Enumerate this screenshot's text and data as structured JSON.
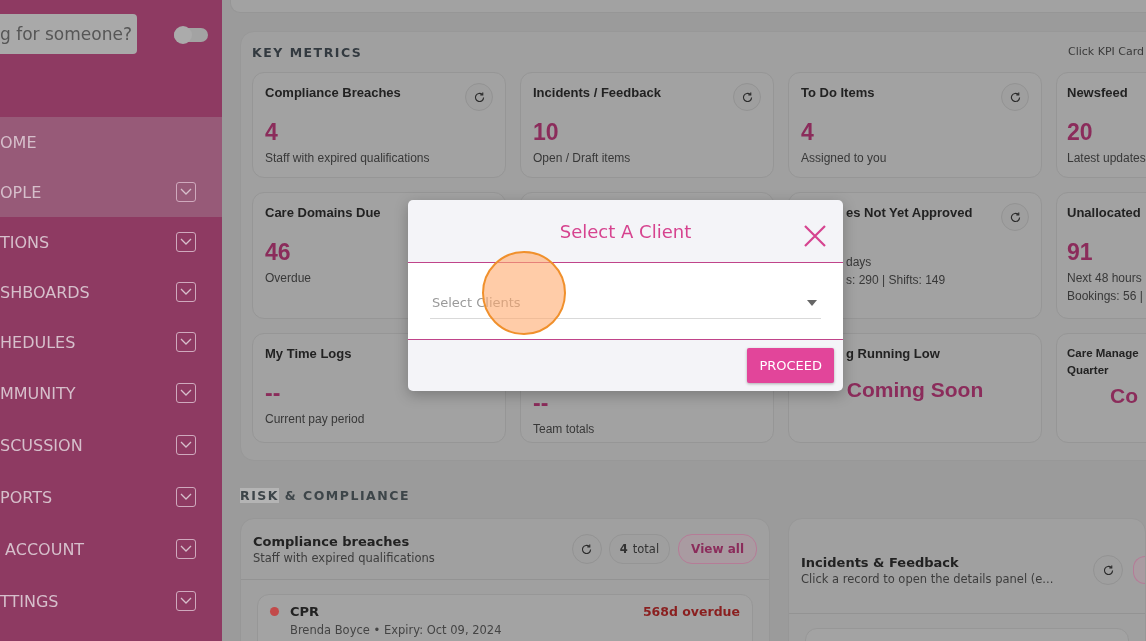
{
  "sidebar": {
    "search": {
      "placeholder": "g for someone?"
    },
    "toggle": {
      "on": false
    },
    "items": [
      {
        "label": "OME",
        "highlighted": true,
        "expandable": false
      },
      {
        "label": "OPLE",
        "highlighted": true,
        "expandable": true
      },
      {
        "label": "TIONS",
        "highlighted": false,
        "expandable": true
      },
      {
        "label": "SHBOARDS",
        "highlighted": false,
        "expandable": true
      },
      {
        "label": "HEDULES",
        "highlighted": false,
        "expandable": true
      },
      {
        "label": "MMUNITY",
        "highlighted": false,
        "expandable": true
      },
      {
        "label": "SCUSSION",
        "highlighted": false,
        "expandable": true
      },
      {
        "label": "PORTS",
        "highlighted": false,
        "expandable": true
      },
      {
        "label": " ACCOUNT",
        "highlighted": false,
        "expandable": true
      },
      {
        "label": "TTINGS",
        "highlighted": false,
        "expandable": true
      }
    ]
  },
  "key_metrics": {
    "heading": "KEY METRICS",
    "hint": "Click KPI Card",
    "cards": [
      {
        "kind": "full",
        "title": "Compliance Breaches",
        "value": "4",
        "lines": [
          "Staff with expired qualifications"
        ],
        "refresh": true
      },
      {
        "kind": "full",
        "title": "Incidents / Feedback",
        "value": "10",
        "lines": [
          "Open / Draft items"
        ],
        "refresh": true
      },
      {
        "kind": "full",
        "title": "To Do Items",
        "value": "4",
        "lines": [
          "Assigned to you"
        ],
        "refresh": true
      },
      {
        "kind": "full",
        "title": "Newsfeed",
        "value": "20",
        "lines": [
          "Latest updates"
        ],
        "refresh": false
      },
      {
        "kind": "full",
        "title": "Care Domains Due",
        "value": "46",
        "lines": [
          "Overdue"
        ],
        "refresh": false
      },
      {
        "kind": "covered",
        "refresh": false
      },
      {
        "kind": "partial",
        "title": "es Not Yet Approved",
        "lines": [
          "days",
          "s: 290 | Shifts: 149"
        ],
        "refresh": true
      },
      {
        "kind": "full",
        "title": "Unallocated",
        "value": "91",
        "lines": [
          "Next 48 hours",
          "Bookings: 56 |"
        ],
        "refresh": false
      },
      {
        "kind": "full",
        "title": "My Time Logs",
        "value": "--",
        "lines": [
          "Current pay period"
        ],
        "refresh": false
      },
      {
        "kind": "full",
        "value": "--",
        "lines": [
          "Team totals"
        ],
        "refresh": false
      },
      {
        "kind": "partial",
        "title": "g Running Low",
        "soon": "Coming Soon",
        "refresh": false
      },
      {
        "kind": "edge",
        "title": "Care Manage\nQuarter",
        "soon": "Co",
        "refresh": false
      }
    ]
  },
  "risk": {
    "heading": [
      {
        "text": "RISK",
        "selected": true
      },
      {
        "text": " & COMPLIANCE",
        "selected": false
      }
    ],
    "panels": [
      {
        "title": "Compliance breaches",
        "subtitle": "Staff with expired qualifications",
        "count": "4",
        "count_label": "total",
        "view_all": "View all",
        "items": [
          {
            "title": "CPR",
            "status": "568d overdue",
            "detail": "Brenda Boyce • Expiry: Oct 09, 2024",
            "color": "#c24a4a"
          }
        ]
      },
      {
        "title": "Incidents & Feedback",
        "subtitle": "Click a record to open the details panel (e..."
      }
    ]
  },
  "dialog": {
    "title": "Select A Client",
    "select": {
      "placeholder": "Select Clients"
    },
    "button": "PROCEED"
  }
}
